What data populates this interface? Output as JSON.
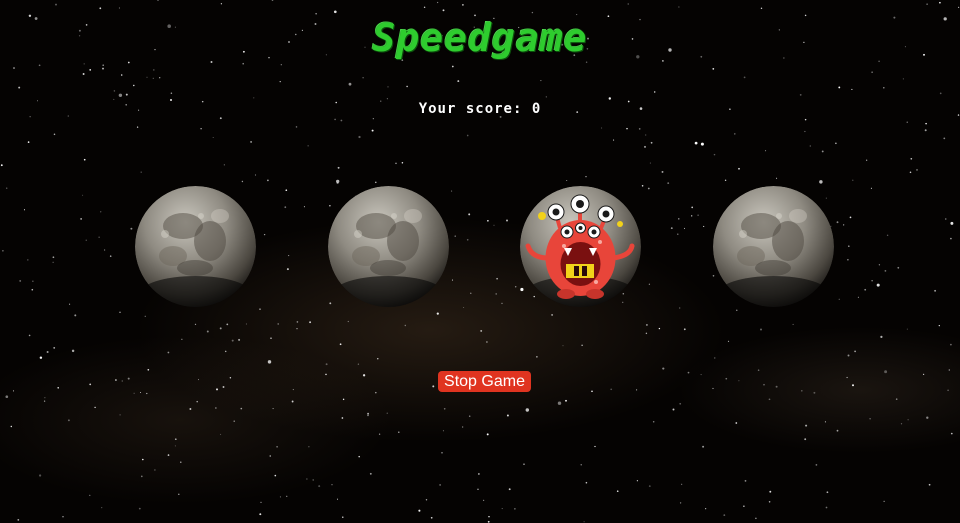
{
  "game": {
    "title": "Speedgame",
    "score_label": "Your score:",
    "score": 0,
    "stop_label": "Stop Game"
  },
  "board": {
    "holes": [
      {
        "content": "moon"
      },
      {
        "content": "moon"
      },
      {
        "content": "monster"
      },
      {
        "content": "moon"
      }
    ]
  },
  "colors": {
    "title": "#2ecc2e",
    "button": "#e03420",
    "monster": "#e8453a"
  }
}
